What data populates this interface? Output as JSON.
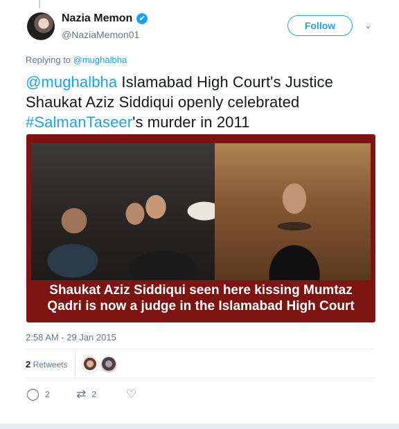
{
  "author": {
    "display_name": "Nazia Memon",
    "handle": "@NaziaMemon01",
    "verified_icon": "✔"
  },
  "follow_label": "Follow",
  "chevron_icon": "⌄",
  "replying": {
    "prefix": "Replying to ",
    "mention": "@mughalbha"
  },
  "tweet": {
    "mention": "@mughalbha",
    "text1": " Islamabad High Court's Justice Shaukat Aziz Siddiqui openly celebrated ",
    "hashtag": "#SalmanTaseer",
    "text2": "'s murder in 2011"
  },
  "media": {
    "caption_line1": "Shaukat Aziz Siddiqui seen here kissing Mumtaz",
    "caption_line2": "Qadri is now a judge in the Islamabad High Court"
  },
  "timestamp": "2:58 AM - 29 Jan 2015",
  "retweets": {
    "count": "2",
    "label": " Retweets"
  },
  "actions": {
    "reply_icon": "◯",
    "reply_count": "2",
    "retweet_icon": "⇄",
    "retweet_count": "2",
    "like_icon": "♡"
  },
  "colors": {
    "accent": "#1da1f2",
    "muted": "#657786",
    "caption_bg": "#7d1412"
  }
}
